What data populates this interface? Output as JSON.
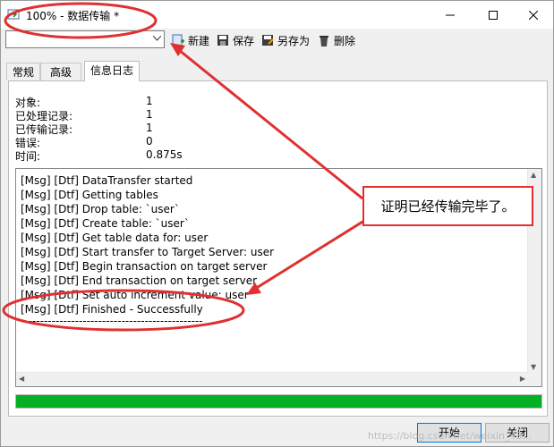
{
  "window": {
    "title": "100% - 数据传输 *"
  },
  "toolbar": {
    "new_label": "新建",
    "save_label": "保存",
    "save_as_label": "另存为",
    "delete_label": "删除",
    "profile_value": ""
  },
  "tabs": [
    {
      "label": "常规"
    },
    {
      "label": "高级"
    },
    {
      "label": "信息日志"
    }
  ],
  "stats": [
    {
      "label": "对象:",
      "value": "1"
    },
    {
      "label": "已处理记录:",
      "value": "1"
    },
    {
      "label": "已传输记录:",
      "value": "1"
    },
    {
      "label": "错误:",
      "value": "0"
    },
    {
      "label": "时间:",
      "value": "0.875s"
    }
  ],
  "log": [
    "[Msg] [Dtf] DataTransfer started",
    "[Msg] [Dtf] Getting tables",
    "[Msg] [Dtf] Drop table: `user`",
    "[Msg] [Dtf] Create table: `user`",
    "[Msg] [Dtf] Get table data for: user",
    "[Msg] [Dtf] Start transfer to Target Server: user",
    "[Msg] [Dtf] Begin transaction on target server",
    "[Msg] [Dtf] End transaction on target server",
    "[Msg] [Dtf] Set auto increment value: user",
    "[Msg] [Dtf] Finished - Successfully",
    "-----------------------------------------------"
  ],
  "progress": {
    "percent": 100,
    "color": "#06b025"
  },
  "buttons": {
    "start_label": "开始",
    "close_label": "关闭"
  },
  "annotation": {
    "text": "证明已经传输完毕了。",
    "color": "#e03030"
  },
  "watermark": "https://blog.csdn.net/weixin_43..."
}
